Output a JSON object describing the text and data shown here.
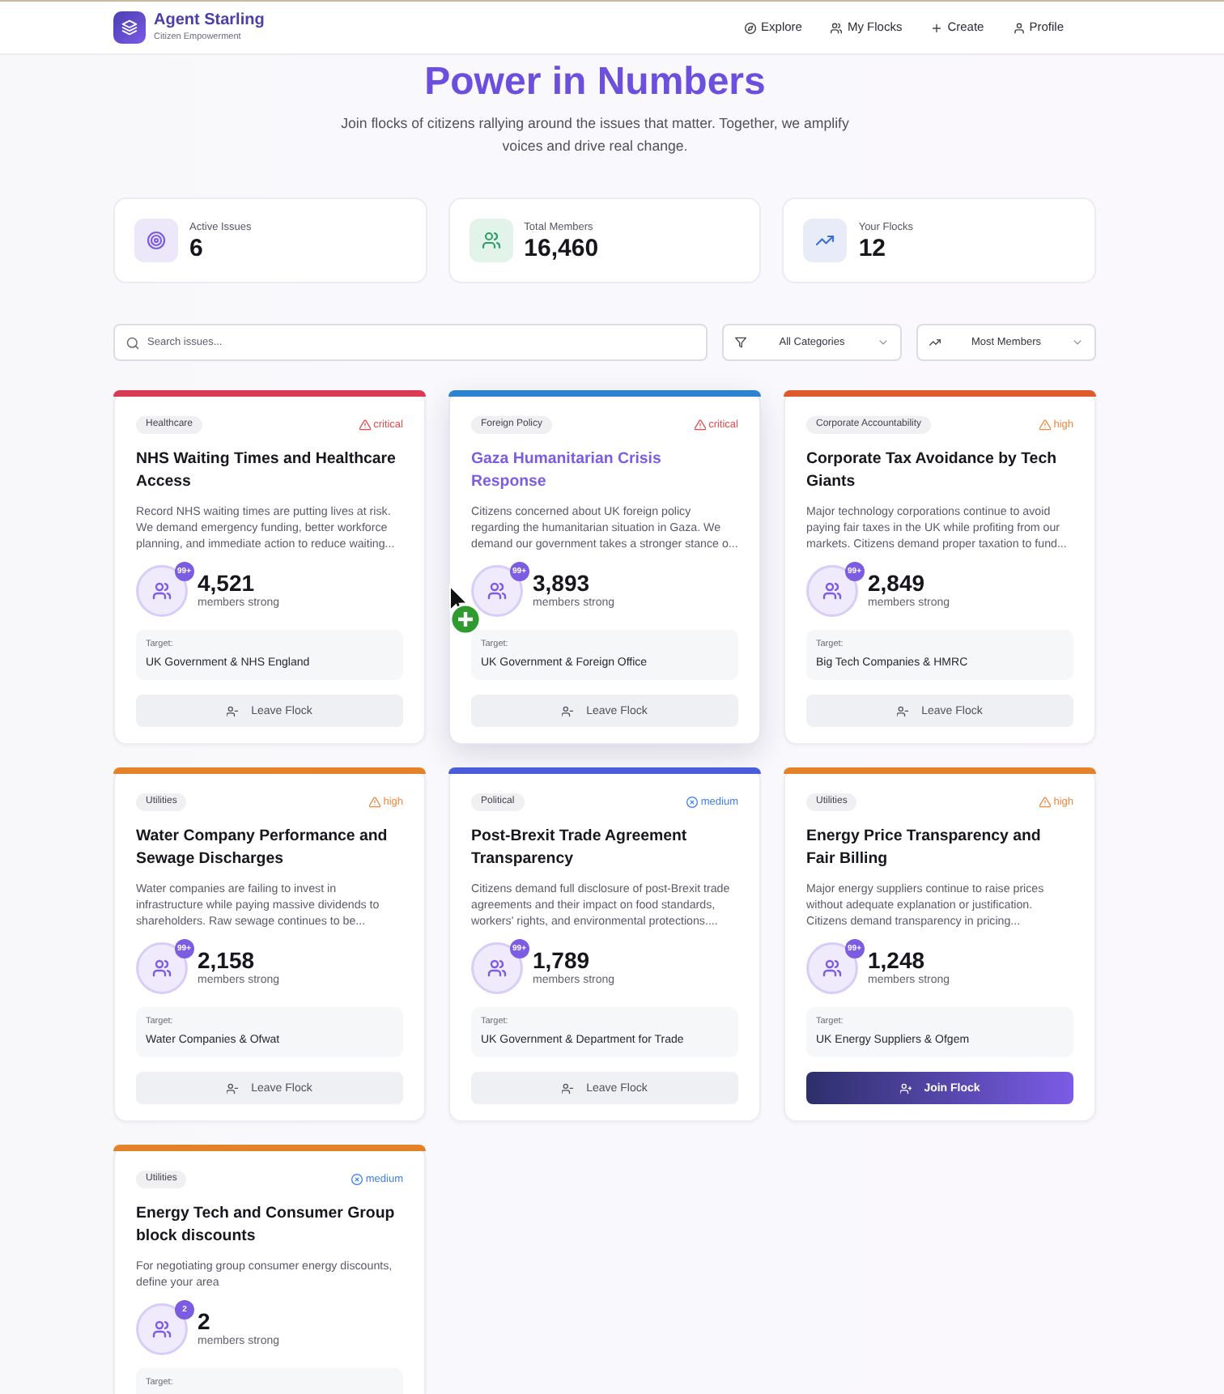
{
  "header": {
    "brand": "Agent Starling",
    "tagline": "Citizen Empowerment",
    "nav": [
      {
        "label": "Explore"
      },
      {
        "label": "My Flocks"
      },
      {
        "label": "Create"
      },
      {
        "label": "Profile"
      }
    ]
  },
  "hero": {
    "title": "Power in Numbers",
    "subtitle": "Join flocks of citizens rallying around the issues that matter. Together, we amplify voices and drive real change."
  },
  "stats": [
    {
      "label": "Active Issues",
      "value": "6"
    },
    {
      "label": "Total Members",
      "value": "16,460"
    },
    {
      "label": "Your Flocks",
      "value": "12"
    }
  ],
  "filters": {
    "search": {
      "placeholder": "Search issues..."
    },
    "category_filter": {
      "value": "All Categories"
    },
    "sort": {
      "value": "Most Members"
    }
  },
  "issues": [
    {
      "category": "Healthcare",
      "color": "#d83b52",
      "severity": {
        "label": "critical",
        "kind": "critical"
      },
      "title": "NHS Waiting Times and Healthcare Access",
      "description": "Record NHS waiting times are putting lives at risk. We demand emergency funding, better workforce planning, and immediate action to reduce waiting...",
      "badge": "99+",
      "members": "4,521",
      "members_label": "members strong",
      "target_label": "Target:",
      "target": "UK Government & NHS England",
      "joined": true,
      "button": "Leave Flock",
      "hovered": false
    },
    {
      "category": "Foreign Policy",
      "color": "#2a82d0",
      "severity": {
        "label": "critical",
        "kind": "critical"
      },
      "title": "Gaza Humanitarian Crisis Response",
      "description": "Citizens concerned about UK foreign policy regarding the humanitarian situation in Gaza. We demand our government takes a stronger stance o...",
      "badge": "99+",
      "members": "3,893",
      "members_label": "members strong",
      "target_label": "Target:",
      "target": "UK Government & Foreign Office",
      "joined": true,
      "button": "Leave Flock",
      "hovered": true
    },
    {
      "category": "Corporate Accountability",
      "color": "#dd5a2c",
      "severity": {
        "label": "high",
        "kind": "high"
      },
      "title": "Corporate Tax Avoidance by Tech Giants",
      "description": "Major technology corporations continue to avoid paying fair taxes in the UK while profiting from our markets. Citizens demand proper taxation to fund...",
      "badge": "99+",
      "members": "2,849",
      "members_label": "members strong",
      "target_label": "Target:",
      "target": "Big Tech Companies & HMRC",
      "joined": true,
      "button": "Leave Flock",
      "hovered": false
    },
    {
      "category": "Utilities",
      "color": "#e4822a",
      "severity": {
        "label": "high",
        "kind": "high"
      },
      "title": "Water Company Performance and Sewage Discharges",
      "description": "Water companies are failing to invest in infrastructure while paying massive dividends to shareholders. Raw sewage continues to be...",
      "badge": "99+",
      "members": "2,158",
      "members_label": "members strong",
      "target_label": "Target:",
      "target": "Water Companies & Ofwat",
      "joined": true,
      "button": "Leave Flock",
      "hovered": false
    },
    {
      "category": "Political",
      "color": "#485cdc",
      "severity": {
        "label": "medium",
        "kind": "medium"
      },
      "title": "Post-Brexit Trade Agreement Transparency",
      "description": "Citizens demand full disclosure of post-Brexit trade agreements and their impact on food standards, workers' rights, and environmental protections....",
      "badge": "99+",
      "members": "1,789",
      "members_label": "members strong",
      "target_label": "Target:",
      "target": "UK Government & Department for Trade",
      "joined": true,
      "button": "Leave Flock",
      "hovered": false
    },
    {
      "category": "Utilities",
      "color": "#e4822a",
      "severity": {
        "label": "high",
        "kind": "high"
      },
      "title": "Energy Price Transparency and Fair Billing",
      "description": "Major energy suppliers continue to raise prices without adequate explanation or justification. Citizens demand transparency in pricing...",
      "badge": "99+",
      "members": "1,248",
      "members_label": "members strong",
      "target_label": "Target:",
      "target": "UK Energy Suppliers & Ofgem",
      "joined": false,
      "button": "Join Flock",
      "hovered": false
    },
    {
      "category": "Utilities",
      "color": "#e4822a",
      "severity": {
        "label": "medium",
        "kind": "medium"
      },
      "title": "Energy Tech and Consumer Group block discounts",
      "description": "For negotiating group consumer energy discounts, define your area",
      "badge": "2",
      "members": "2",
      "members_label": "members strong",
      "target_label": "Target:",
      "hovered": false
    }
  ]
}
